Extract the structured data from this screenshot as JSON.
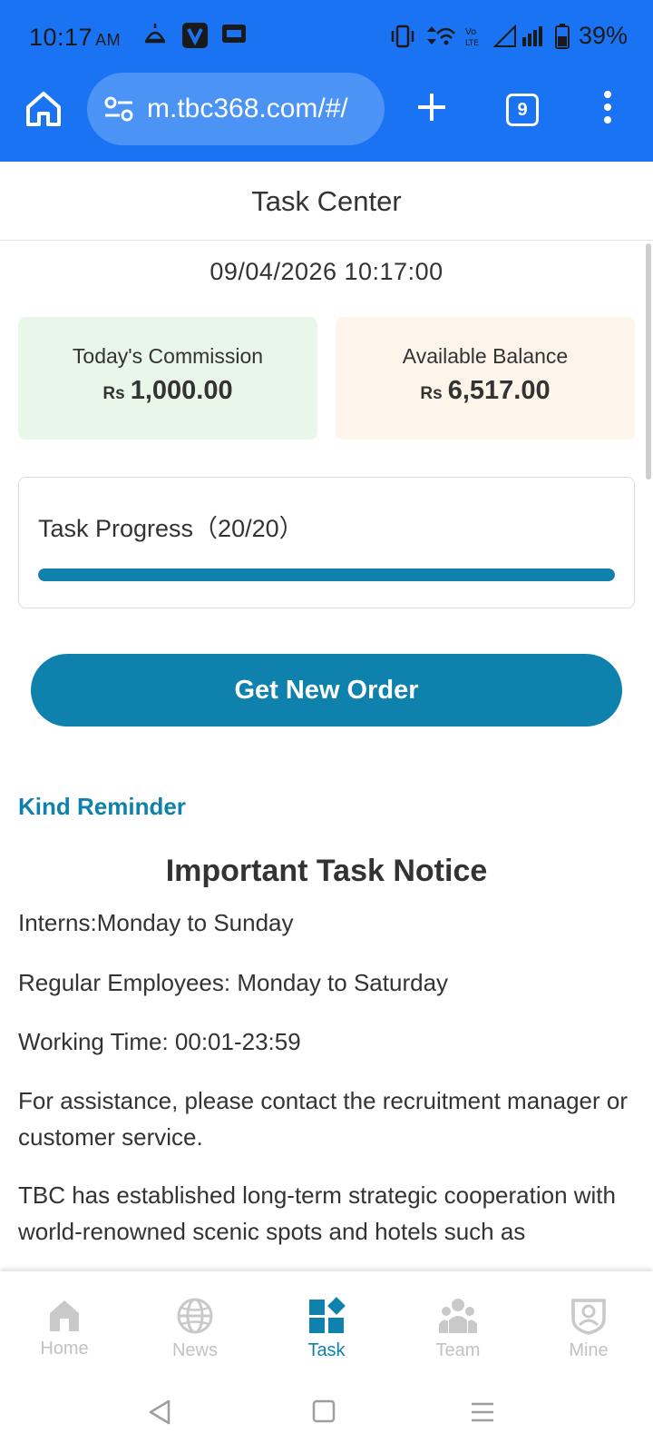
{
  "status_bar": {
    "time": "10:17",
    "ampm": "AM",
    "battery": "39%"
  },
  "browser": {
    "url": "m.tbc368.com/#/",
    "tab_count": "9"
  },
  "page": {
    "title": "Task Center",
    "datetime": "09/04/2026 10:17:00"
  },
  "cards": {
    "commission": {
      "label": "Today's Commission",
      "currency": "Rs",
      "value": "1,000.00"
    },
    "balance": {
      "label": "Available Balance",
      "currency": "Rs",
      "value": "6,517.00"
    }
  },
  "progress": {
    "label": "Task Progress（20/20）",
    "done": 20,
    "total": 20
  },
  "order_button": "Get New Order",
  "reminder": {
    "heading": "Kind Reminder",
    "title": "Important Task Notice",
    "lines": [
      "Interns:Monday to Sunday",
      "Regular Employees: Monday to Saturday",
      "Working Time: 00:01-23:59",
      "For assistance, please contact the recruitment manager or customer service.",
      "TBC has established long-term strategic cooperation with world-renowned scenic spots and hotels such as"
    ]
  },
  "nav": [
    {
      "label": "Home",
      "icon": "home-icon"
    },
    {
      "label": "News",
      "icon": "globe-icon"
    },
    {
      "label": "Task",
      "icon": "task-grid-icon",
      "active": true
    },
    {
      "label": "Team",
      "icon": "team-icon"
    },
    {
      "label": "Mine",
      "icon": "profile-icon"
    }
  ],
  "colors": {
    "chrome": "#1a73f2",
    "accent": "#0e82ac",
    "commission_bg": "#e9f6ea",
    "balance_bg": "#fdf5ea"
  }
}
